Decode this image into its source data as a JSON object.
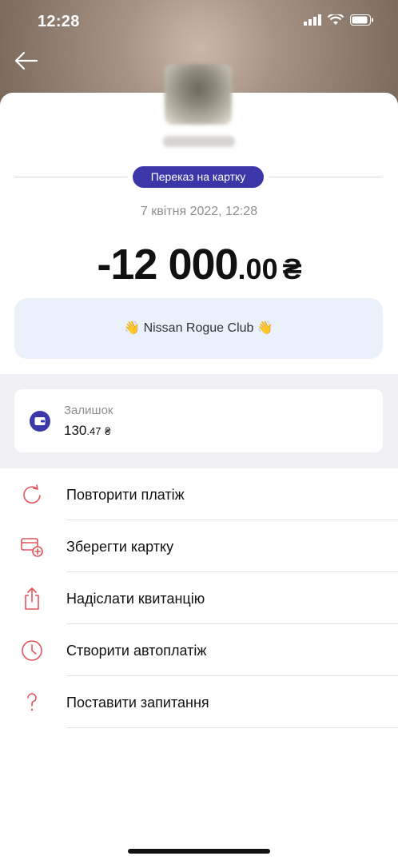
{
  "status_bar": {
    "time": "12:28"
  },
  "header": {
    "tag": "Переказ на картку",
    "date": "7 квітня 2022, 12:28"
  },
  "amount": {
    "main": "-12 000",
    "cents": ".00",
    "currency": "₴"
  },
  "comment": "👋 Nissan Rogue Club 👋",
  "balance": {
    "label": "Залишок",
    "main": "130",
    "cents": ".47",
    "currency": "₴"
  },
  "actions": [
    {
      "label": "Повторити платіж",
      "icon": "repeat-icon"
    },
    {
      "label": "Зберегти картку",
      "icon": "save-card-icon"
    },
    {
      "label": "Надіслати квитанцію",
      "icon": "share-icon"
    },
    {
      "label": "Створити автоплатіж",
      "icon": "clock-icon"
    },
    {
      "label": "Поставити запитання",
      "icon": "question-icon"
    }
  ],
  "colors": {
    "accent": "#3b37a8",
    "icon_red": "#e2545c",
    "comment_bg": "#eaf1fb",
    "band_bg": "#efeff4"
  }
}
